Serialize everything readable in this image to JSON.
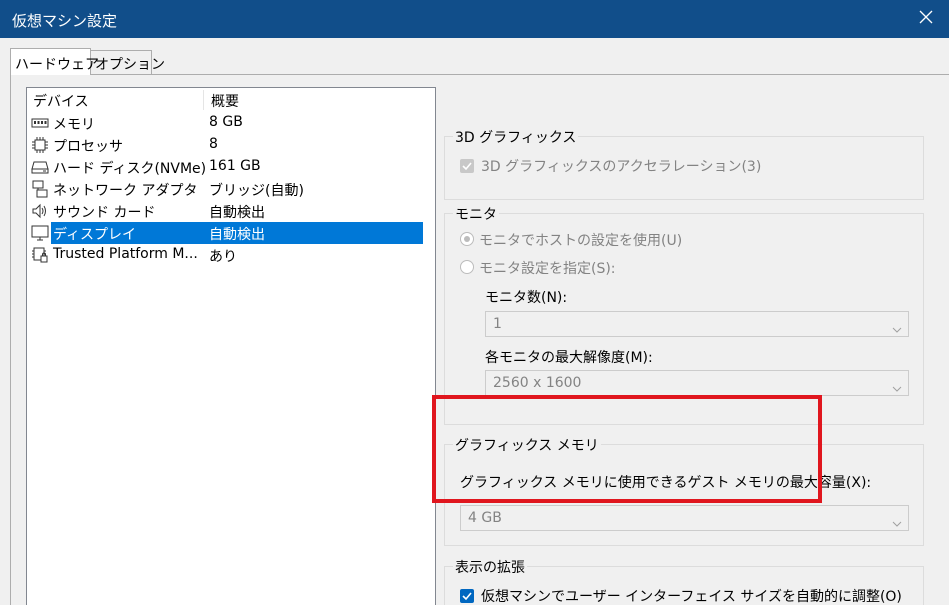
{
  "window": {
    "title": "仮想マシン設定",
    "close_icon": "close-icon"
  },
  "tabs": [
    {
      "label": "ハードウェア",
      "active": true
    },
    {
      "label": "オプション",
      "active": false
    }
  ],
  "device_list": {
    "headers": {
      "device": "デバイス",
      "summary": "概要"
    },
    "items": [
      {
        "icon": "memory-icon",
        "name": "メモリ",
        "summary": "8 GB"
      },
      {
        "icon": "processor-icon",
        "name": "プロセッサ",
        "summary": "8"
      },
      {
        "icon": "hard-disk-icon",
        "name": "ハード ディスク(NVMe)",
        "summary": "161 GB"
      },
      {
        "icon": "network-adapter-icon",
        "name": "ネットワーク アダプタ",
        "summary": "ブリッジ(自動)"
      },
      {
        "icon": "sound-card-icon",
        "name": "サウンド カード",
        "summary": "自動検出"
      },
      {
        "icon": "display-icon",
        "name": "ディスプレイ",
        "summary": "自動検出",
        "selected": true
      },
      {
        "icon": "tpm-icon",
        "name": "Trusted Platform M...",
        "summary": "あり"
      }
    ]
  },
  "graphics3d": {
    "group_label": "3D グラフィックス",
    "accel_label": "3D グラフィックスのアクセラレーション(3)",
    "accel_checked": true
  },
  "monitor": {
    "group_label": "モニタ",
    "use_host_label": "モニタでホストの設定を使用(U)",
    "specify_label": "モニタ設定を指定(S):",
    "count_label": "モニタ数(N):",
    "count_value": "1",
    "max_res_label": "各モニタの最大解像度(M):",
    "max_res_value": "2560 x 1600"
  },
  "graphics_memory": {
    "group_label": "グラフィックス メモリ",
    "desc_label": "グラフィックス メモリに使用できるゲスト メモリの最大容量(X):",
    "value": "4 GB"
  },
  "display_scaling": {
    "group_label": "表示の拡張",
    "auto_adjust_label": "仮想マシンでユーザー インターフェイス サイズを自動的に調整(O)",
    "auto_adjust_checked": true
  },
  "colors": {
    "titlebar": "#114e8a",
    "selection": "#0078d7",
    "highlight_box": "#e0161e",
    "checkbox_enabled": "#0067c0"
  }
}
